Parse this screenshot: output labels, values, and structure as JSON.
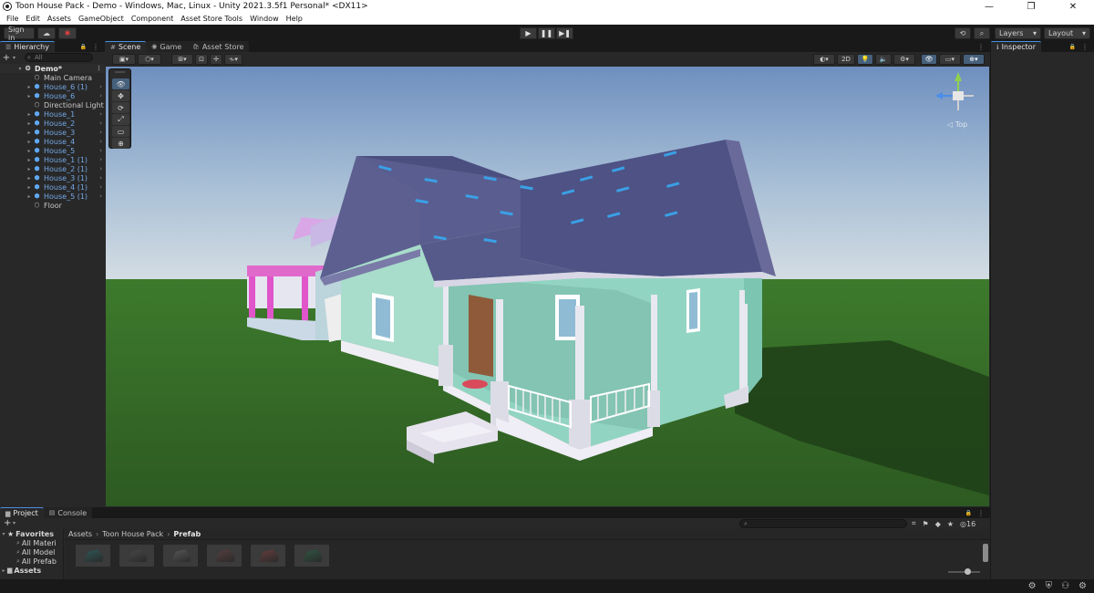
{
  "window": {
    "title": "Toon House Pack - Demo - Windows, Mac, Linux - Unity 2021.3.5f1 Personal* <DX11>",
    "controls": [
      "—",
      "❐",
      "✕"
    ]
  },
  "menu": [
    "File",
    "Edit",
    "Assets",
    "GameObject",
    "Component",
    "Asset Store Tools",
    "Window",
    "Help"
  ],
  "toolbar": {
    "sign_in": "Sign in",
    "cloud_icon": "☁",
    "collab_icon": "✱",
    "play_icon": "▶",
    "pause_icon": "❚❚",
    "step_icon": "▶❚",
    "history_icon": "⟲",
    "search_icon": "⌕",
    "layers": "Layers",
    "layout": "Layout",
    "dropdown_arrow": "▾"
  },
  "hierarchy": {
    "tab": "Hierarchy",
    "tab_icon": "☰",
    "lock_icon": "🔒",
    "menu_icon": "⋮",
    "add_icon": "+",
    "add_arrow": "▾",
    "search_placeholder": "All",
    "search_icon": "⌕",
    "root": {
      "label": "Demo*",
      "icon": "❂",
      "arrow": "▾",
      "menu": "⋮"
    },
    "expand_arrow": "▸",
    "row_chevron": "›",
    "prefab_icon": "⬢",
    "object_icon": "⬡",
    "items": [
      {
        "label": "Main Camera",
        "prefab": false,
        "expandable": false
      },
      {
        "label": "House_6 (1)",
        "prefab": true,
        "expandable": true
      },
      {
        "label": "House_6",
        "prefab": true,
        "expandable": true
      },
      {
        "label": "Directional Light",
        "prefab": false,
        "expandable": false
      },
      {
        "label": "House_1",
        "prefab": true,
        "expandable": true
      },
      {
        "label": "House_2",
        "prefab": true,
        "expandable": true
      },
      {
        "label": "House_3",
        "prefab": true,
        "expandable": true
      },
      {
        "label": "House_4",
        "prefab": true,
        "expandable": true
      },
      {
        "label": "House_5",
        "prefab": true,
        "expandable": true
      },
      {
        "label": "House_1 (1)",
        "prefab": true,
        "expandable": true
      },
      {
        "label": "House_2 (1)",
        "prefab": true,
        "expandable": true
      },
      {
        "label": "House_3 (1)",
        "prefab": true,
        "expandable": true
      },
      {
        "label": "House_4 (1)",
        "prefab": true,
        "expandable": true
      },
      {
        "label": "House_5 (1)",
        "prefab": true,
        "expandable": true
      },
      {
        "label": "Floor",
        "prefab": false,
        "expandable": false
      }
    ]
  },
  "scene": {
    "tabs": [
      {
        "label": "Scene",
        "icon": "#",
        "active": true
      },
      {
        "label": "Game",
        "icon": "◉",
        "active": false
      },
      {
        "label": "Asset Store",
        "icon": "🛍",
        "active": false
      }
    ],
    "tab_menu": "⋮",
    "toolbar_left": [
      "▣▾",
      "⬡▾",
      "⊞▾",
      "⊡",
      "✢",
      "⟛▾"
    ],
    "toolbar_right": [
      "◐▾",
      "2D",
      "💡",
      "🔈",
      "⚙▾",
      "👁",
      "▭▾",
      "⊕▾"
    ],
    "tools": [
      "👁",
      "✥",
      "⟳",
      "⤢",
      "▭",
      "⊕"
    ],
    "gizmo_label": "◁ Top"
  },
  "inspector": {
    "tab": "Inspector",
    "tab_icon": "ℹ",
    "lock_icon": "🔒",
    "menu_icon": "⋮"
  },
  "project": {
    "tabs": [
      {
        "label": "Project",
        "icon": "▆",
        "active": true
      },
      {
        "label": "Console",
        "icon": "▤",
        "active": false
      }
    ],
    "lock_icon": "🔒",
    "menu_icon": "⋮",
    "add_icon": "+",
    "add_arrow": "▾",
    "search_icon": "⌕",
    "right_icons": [
      "⌗",
      "⚑",
      "◆",
      "★"
    ],
    "hidden_count": "◎16",
    "favorites_label": "Favorites",
    "favorites_icons": {
      "arrow": "▾",
      "star": "★",
      "search": "⌕"
    },
    "favorites": [
      "All Materi",
      "All Model",
      "All Prefab"
    ],
    "assets_label": "Assets",
    "assets_icons": {
      "arrow": "▸",
      "folder": "▆"
    },
    "breadcrumb": [
      "Assets",
      "Toon House Pack",
      "Prefab"
    ],
    "breadcrumb_sep": "›",
    "thumb_colors": [
      "#2f5a5a",
      "#4a4a4a",
      "#5a5a5a",
      "#5a4040",
      "#6a3f3f",
      "#2f5a45"
    ]
  },
  "status": {
    "icons": [
      "⚙",
      "⛨",
      "⚇",
      "⚙"
    ]
  }
}
